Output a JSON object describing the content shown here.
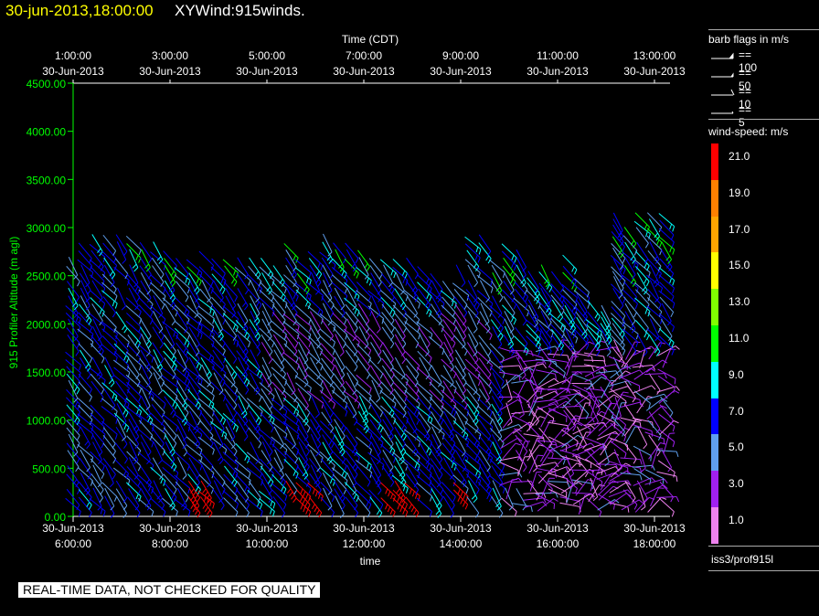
{
  "header": {
    "date": "30-jun-2013,18:00:00",
    "title": "XYWind:915winds."
  },
  "legend": {
    "barb_title": "barb flags in m/s",
    "barbs": [
      {
        "label": "== 100",
        "kind": "flag"
      },
      {
        "label": "== 50",
        "kind": "triangle"
      },
      {
        "label": "== 10",
        "kind": "full"
      },
      {
        "label": "== 5",
        "kind": "half"
      }
    ],
    "speed_title": "wind-speed: m/s",
    "speed_levels": [
      {
        "label": "21.0",
        "color": "#ff0000"
      },
      {
        "label": "19.0",
        "color": "#ff8000"
      },
      {
        "label": "17.0",
        "color": "#ffa500"
      },
      {
        "label": "15.0",
        "color": "#ffff00"
      },
      {
        "label": "13.0",
        "color": "#80ff00"
      },
      {
        "label": "11.0",
        "color": "#00ff00"
      },
      {
        "label": "9.0",
        "color": "#00ffff"
      },
      {
        "label": "7.0",
        "color": "#0000ff"
      },
      {
        "label": "5.0",
        "color": "#5f9fef"
      },
      {
        "label": "3.0",
        "color": "#a020f0"
      },
      {
        "label": "1.0",
        "color": "#ee82ee"
      }
    ],
    "source": "iss3/prof915l"
  },
  "disclaimer": "REAL-TIME DATA, NOT CHECKED FOR QUALITY",
  "chart_data": {
    "type": "scatter",
    "title": "XYWind:915winds.",
    "xlabel": "time",
    "x2label": "Time (CDT)",
    "ylabel": "915 Profiler Altitude (m agl)",
    "ylim": [
      0,
      4500
    ],
    "yticks": [
      "0.00",
      "500.00",
      "1000.00",
      "1500.00",
      "2000.00",
      "2500.00",
      "3000.00",
      "3500.00",
      "4000.00",
      "4500.00"
    ],
    "xticks_bottom": [
      {
        "date": "30-Jun-2013",
        "time": "6:00:00"
      },
      {
        "date": "30-Jun-2013",
        "time": "8:00:00"
      },
      {
        "date": "30-Jun-2013",
        "time": "10:00:00"
      },
      {
        "date": "30-Jun-2013",
        "time": "12:00:00"
      },
      {
        "date": "30-Jun-2013",
        "time": "14:00:00"
      },
      {
        "date": "30-Jun-2013",
        "time": "16:00:00"
      },
      {
        "date": "30-Jun-2013",
        "time": "18:00:00"
      }
    ],
    "xticks_top": [
      {
        "time": "1:00:00",
        "date": "30-Jun-2013"
      },
      {
        "time": "3:00:00",
        "date": "30-Jun-2013"
      },
      {
        "time": "5:00:00",
        "date": "30-Jun-2013"
      },
      {
        "time": "7:00:00",
        "date": "30-Jun-2013"
      },
      {
        "time": "9:00:00",
        "date": "30-Jun-2013"
      },
      {
        "time": "11:00:00",
        "date": "30-Jun-2013"
      },
      {
        "time": "13:00:00",
        "date": "30-Jun-2013"
      }
    ],
    "xlim_hours": [
      6,
      18.5
    ],
    "profile_times_hours": [
      6.0,
      6.25,
      6.5,
      6.75,
      7.0,
      7.25,
      7.5,
      7.75,
      8.0,
      8.25,
      8.5,
      8.75,
      9.0,
      9.25,
      9.5,
      9.75,
      10.0,
      10.25,
      10.5,
      10.75,
      11.0,
      11.25,
      11.5,
      11.75,
      12.0,
      12.25,
      12.5,
      12.75,
      13.0,
      13.25,
      13.5,
      13.75,
      14.0,
      14.25,
      14.5,
      14.75,
      15.0,
      15.25,
      15.5,
      15.75,
      16.0,
      16.25,
      16.5,
      16.75,
      17.0,
      17.25,
      17.5,
      17.75,
      18.0,
      18.25
    ],
    "profile_top_altitude_m": [
      2750,
      2800,
      2850,
      2900,
      2950,
      2850,
      2800,
      2800,
      2700,
      2600,
      2650,
      2700,
      2650,
      2600,
      2600,
      2650,
      2650,
      2550,
      2800,
      2750,
      2750,
      2850,
      2800,
      2800,
      2750,
      2650,
      2600,
      2600,
      2600,
      2550,
      2500,
      2500,
      2550,
      2900,
      2850,
      2600,
      2800,
      2700,
      2500,
      2550,
      2500,
      2650,
      2400,
      2200,
      2100,
      3100,
      3050,
      3150,
      3100,
      3150
    ],
    "series": [
      {
        "name": "1.0",
        "speed_m_s": 1
      },
      {
        "name": "3.0",
        "speed_m_s": 3
      },
      {
        "name": "5.0",
        "speed_m_s": 5
      },
      {
        "name": "7.0",
        "speed_m_s": 7
      },
      {
        "name": "9.0",
        "speed_m_s": 9
      },
      {
        "name": "11.0",
        "speed_m_s": 11
      },
      {
        "name": "13.0",
        "speed_m_s": 13
      },
      {
        "name": "21.0",
        "speed_m_s": 21
      }
    ]
  }
}
